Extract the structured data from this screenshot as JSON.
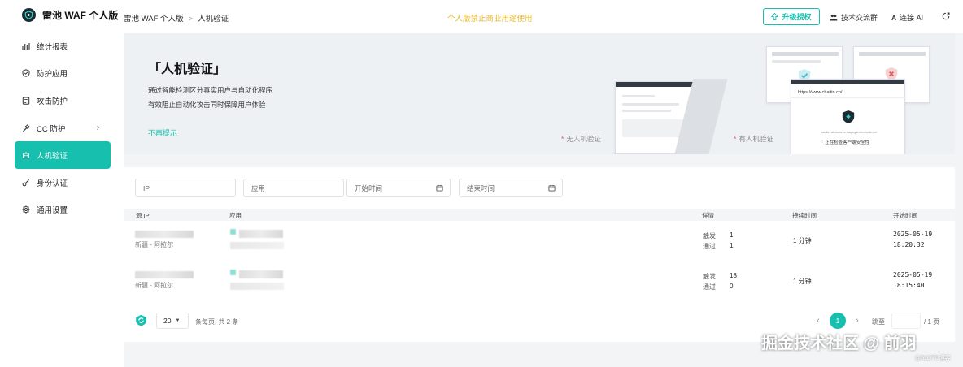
{
  "app": {
    "name": "雷池 WAF 个人版"
  },
  "sidebar": {
    "items": [
      {
        "label": "统计报表",
        "icon": "bar-chart-icon"
      },
      {
        "label": "防护应用",
        "icon": "shield-icon"
      },
      {
        "label": "攻击防护",
        "icon": "document-icon"
      },
      {
        "label": "CC 防护",
        "icon": "hammer-icon",
        "has_submenu": true
      },
      {
        "label": "人机验证",
        "icon": "robot-icon",
        "active": true
      },
      {
        "label": "身份认证",
        "icon": "key-icon"
      },
      {
        "label": "通用设置",
        "icon": "gear-icon"
      }
    ]
  },
  "header": {
    "breadcrumb": [
      "雷池 WAF 个人版",
      "人机验证"
    ],
    "notice": "个人版禁止商业用途使用",
    "upgrade_label": "升级授权",
    "community_label": "技术交流群",
    "ai_label": "连接 AI"
  },
  "banner": {
    "title": "「人机验证」",
    "desc_line1": "通过智能检测区分真实用户与自动化程序",
    "desc_line2": "有效阻止自动化攻击同时保障用户体验",
    "dismiss_label": "不再提示",
    "caption_without": "无人机验证",
    "caption_with": "有人机验证",
    "mock_url": "https://www.chaitin.cn/",
    "mock_small_text": "Installer.windows.co.stagingdev.io.chaitin.net",
    "mock_status": "正在检查客户端安全性"
  },
  "filters": {
    "ip_placeholder": "IP",
    "app_placeholder": "应用",
    "start_placeholder": "开始时间",
    "end_placeholder": "结束时间"
  },
  "table": {
    "columns": [
      "源 IP",
      "应用",
      "详情",
      "持续时间",
      "开始时间"
    ],
    "detail_labels": {
      "triggered": "触发",
      "passed": "通过"
    },
    "rows": [
      {
        "location": "新疆 - 阿拉尔",
        "triggered": "1",
        "passed": "1",
        "duration": "1 分钟",
        "start_date": "2025-05-19",
        "start_time": "18:20:32"
      },
      {
        "location": "新疆 - 阿拉尔",
        "triggered": "18",
        "passed": "0",
        "duration": "1 分钟",
        "start_date": "2025-05-19",
        "start_time": "18:15:40"
      }
    ]
  },
  "pagination": {
    "page_size": "20",
    "summary": "条每页, 共 2 条",
    "current_page": "1",
    "goto_label": "跳至",
    "total_pages_label": "/ 1 页"
  },
  "watermark": {
    "main": "掘金技术社区 @ 前羽",
    "sub": "@51CTO博客"
  },
  "colors": {
    "accent": "#17bfae",
    "notice": "#e8b830",
    "sidebar_bg": "#ffffff",
    "page_bg": "#f2f4f5"
  }
}
